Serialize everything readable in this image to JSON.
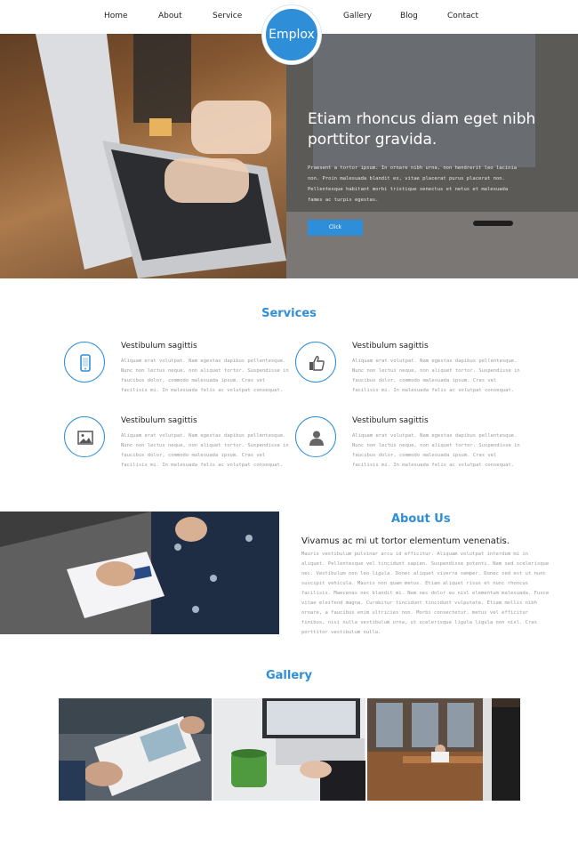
{
  "nav": {
    "items": [
      "Home",
      "About",
      "Service",
      "Gallery",
      "Blog",
      "Contact"
    ],
    "logo": "Emplox"
  },
  "hero": {
    "title": "Etiam rhoncus diam eget nibh porttitor gravida.",
    "body": "Praesent a tortor ipsum. In ornare nibh urna, non hendrerit leo lacinia non. Proin malesuada blandit ex, vitae placerat purus placerat non. Pellentesque habitant morbi tristique senectus et netus et malesuada fames ac turpis egestas.",
    "button": "Click"
  },
  "services": {
    "title": "Services",
    "items": [
      {
        "icon": "phone-icon",
        "title": "Vestibulum sagittis",
        "text": "Aliquam erat volutpat. Nam egestas dapibus pellentesque. Nunc non lectus neque, non aliquet tortor. Suspendisse in faucibus dolor, commodo malesuada ipsum. Cras vel facilisis mi. In malesuada felis ac volutpat consequat."
      },
      {
        "icon": "thumbs-up-icon",
        "title": "Vestibulum sagittis",
        "text": "Aliquam erat volutpat. Nam egestas dapibus pellentesque. Nunc non lectus neque, non aliquet tortor. Suspendisse in faucibus dolor, commodo malesuada ipsum. Cras vel facilisis mi. In malesuada felis ac volutpat consequat."
      },
      {
        "icon": "image-icon",
        "title": "Vestibulum sagittis",
        "text": "Aliquam erat volutpat. Nam egestas dapibus pellentesque. Nunc non lectus neque, non aliquet tortor. Suspendisse in faucibus dolor, commodo malesuada ipsum. Cras vel facilisis mi. In malesuada felis ac volutpat consequat."
      },
      {
        "icon": "user-icon",
        "title": "Vestibulum sagittis",
        "text": "Aliquam erat volutpat. Nam egestas dapibus pellentesque. Nunc non lectus neque, non aliquet tortor. Suspendisse in faucibus dolor, commodo malesuada ipsum. Cras vel facilisis mi. In malesuada felis ac volutpat consequat."
      }
    ]
  },
  "about": {
    "title": "About Us",
    "subtitle": "Vivamus ac mi ut tortor elementum venenatis.",
    "text": "Mauris vestibulum pulvinar arcu id efficitur. Aliquam volutpat interdum mi in aliquet. Pellentesque vel tincidunt sapien. Suspendisse potenti. Nam sed scelerisque nec. Vestibulum non leo ligula. Donec aliquet viverra semper. Donec sed est ut nunc suscipit vehicula. Mauris non quam metus. Etiam aliquet risus et nunc rhoncus facilisis. Maecenas nec blandit mi. Nam nec dolor eu nisl elementum malesuada. Fusce vitae eleifend magna. Curabitur tincidunt tincidunt vulputate. Etiam mollis nibh ornare, a faucibus enim ultricies non. Morbi consectetur, metus vel efficitur finibus, nisi nulla vestibulum urna, ut scelerisque ligula ligula non nisl. Cras porttitor vestibulum nulla."
  },
  "gallery": {
    "title": "Gallery"
  },
  "colors": {
    "accent": "#2f8ed8"
  }
}
